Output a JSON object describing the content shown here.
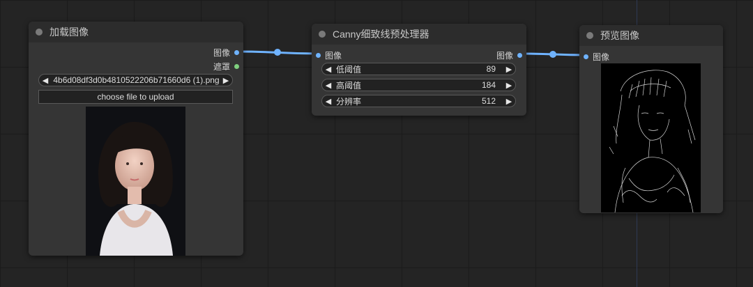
{
  "nodes": {
    "load_image": {
      "title": "加载图像",
      "outputs": {
        "image": "图像",
        "mask": "遮罩"
      },
      "file": "4b6d08df3d0b4810522206b71660d6 (1).png",
      "upload_label": "choose file to upload"
    },
    "canny": {
      "title": "Canny细致线预处理器",
      "input": "图像",
      "output": "图像",
      "params": [
        {
          "label": "低阈值",
          "value": "89"
        },
        {
          "label": "高阈值",
          "value": "184"
        },
        {
          "label": "分辨率",
          "value": "512"
        }
      ]
    },
    "preview": {
      "title": "预览图像",
      "input": "图像"
    }
  },
  "colors": {
    "image_link": "#6fb3ff",
    "mask_slot": "#7fd07f",
    "canvas": "#242424"
  },
  "icons": {
    "left_arrow": "◀",
    "right_arrow": "▶"
  }
}
